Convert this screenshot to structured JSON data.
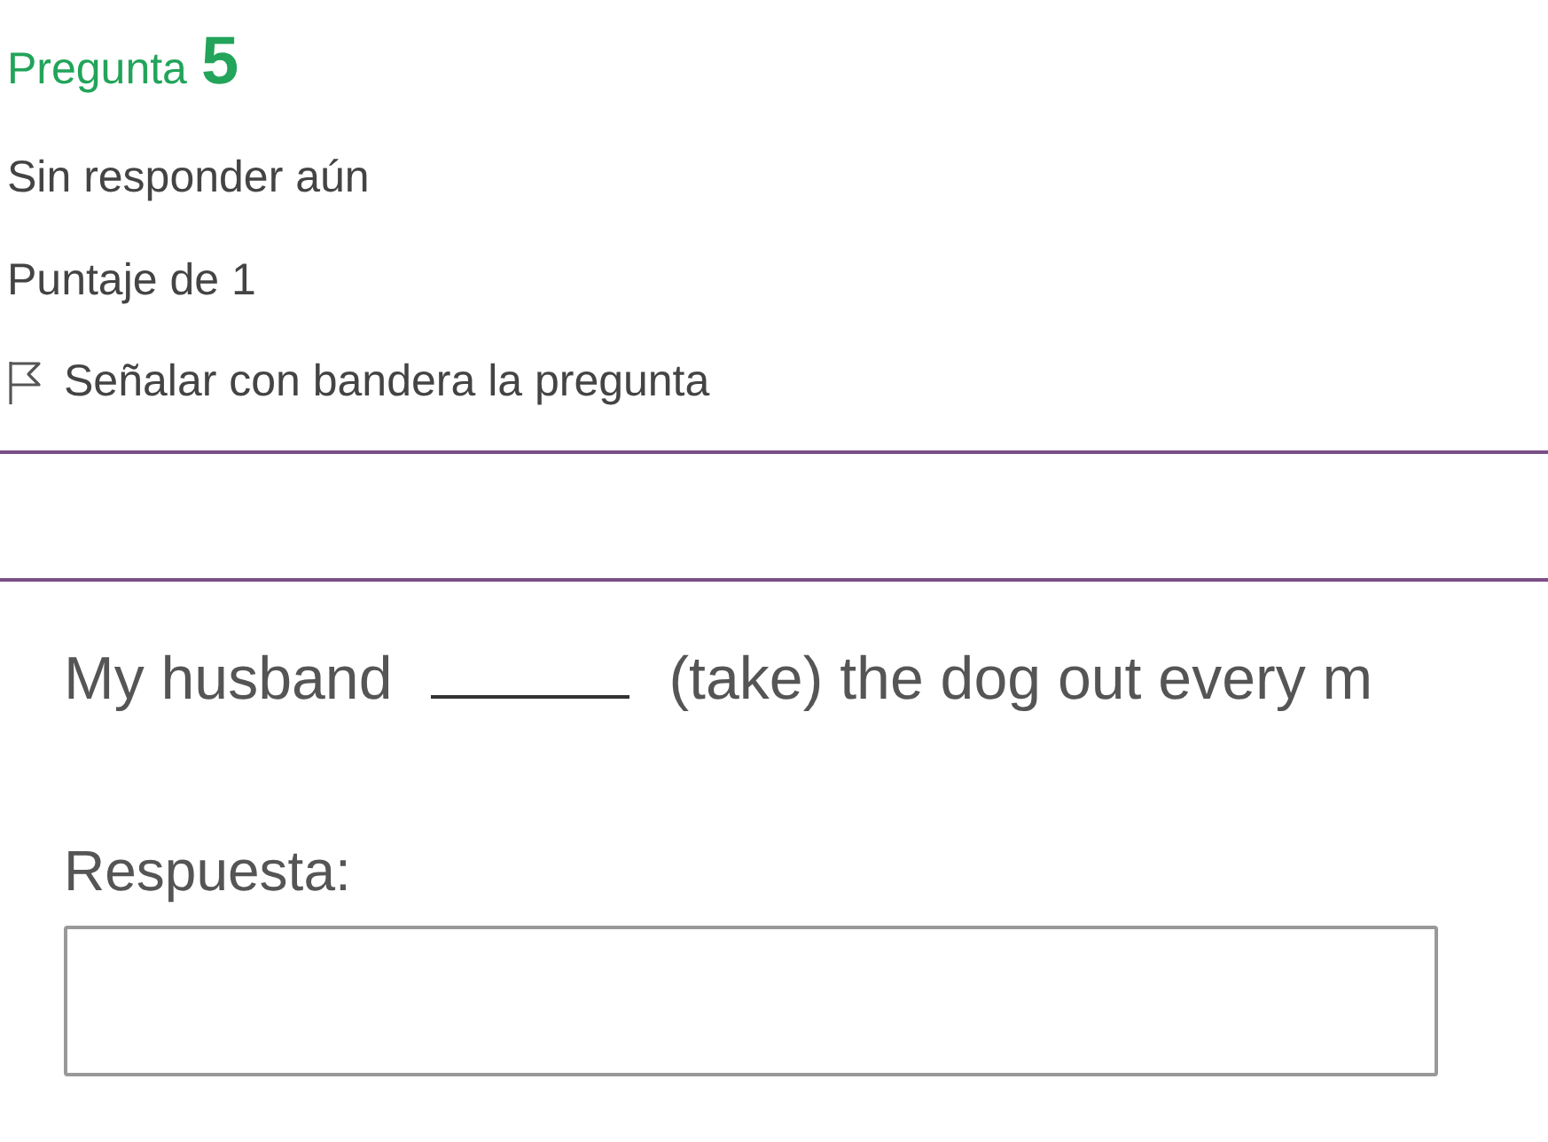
{
  "question": {
    "label": "Pregunta",
    "number": "5",
    "status": "Sin responder aún",
    "points": "Puntaje de 1",
    "flag": {
      "label": "Señalar con bandera la pregunta",
      "flagged": false
    }
  },
  "prompt": {
    "before": "My husband",
    "after": "(take) the dog out every m"
  },
  "answer": {
    "label": "Respuesta:"
  }
}
